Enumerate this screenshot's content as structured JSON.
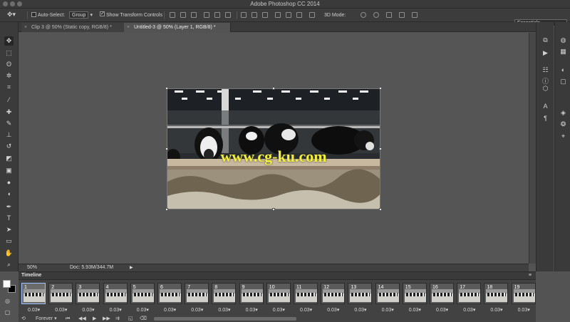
{
  "window": {
    "title": "Adobe Photoshop CC 2014"
  },
  "options_bar": {
    "auto_select_label": "Auto-Select:",
    "auto_select_value": "Group",
    "show_transform_label": "Show Transform Controls",
    "mode_3d_label": "3D Mode:",
    "workspace": "Essentials"
  },
  "tabs": [
    {
      "label": "Clip 3 @ 50% (Static copy, RGB/8) *"
    },
    {
      "label": "Untitled-3 @ 50% (Layer 1, RGB/8) *"
    }
  ],
  "document": {
    "watermark": "www.cg-ku.com"
  },
  "status": {
    "zoom": "50%",
    "doc_size": "Doc: 5.93M/344.7M"
  },
  "timeline": {
    "title": "Timeline",
    "loop": "Forever",
    "frames": [
      {
        "num": "1",
        "delay": "0.03"
      },
      {
        "num": "2",
        "delay": "0.03"
      },
      {
        "num": "3",
        "delay": "0.03"
      },
      {
        "num": "4",
        "delay": "0.03"
      },
      {
        "num": "5",
        "delay": "0.03"
      },
      {
        "num": "6",
        "delay": "0.03"
      },
      {
        "num": "7",
        "delay": "0.03"
      },
      {
        "num": "8",
        "delay": "0.03"
      },
      {
        "num": "9",
        "delay": "0.03"
      },
      {
        "num": "10",
        "delay": "0.03"
      },
      {
        "num": "11",
        "delay": "0.03"
      },
      {
        "num": "12",
        "delay": "0.03"
      },
      {
        "num": "13",
        "delay": "0.03"
      },
      {
        "num": "14",
        "delay": "0.03"
      },
      {
        "num": "15",
        "delay": "0.03"
      },
      {
        "num": "16",
        "delay": "0.03"
      },
      {
        "num": "17",
        "delay": "0.03"
      },
      {
        "num": "18",
        "delay": "0.03"
      },
      {
        "num": "19",
        "delay": "0.03"
      }
    ]
  },
  "colors": {
    "foreground": "#ffffff",
    "background": "#000000",
    "accent": "#9cc3ff"
  },
  "icons": {
    "tools": [
      "move-icon",
      "marquee-icon",
      "lasso-icon",
      "quick-select-icon",
      "crop-icon",
      "eyedropper-icon",
      "healing-icon",
      "brush-icon",
      "stamp-icon",
      "history-brush-icon",
      "eraser-icon",
      "gradient-icon",
      "blur-icon",
      "dodge-icon",
      "pen-icon",
      "type-icon",
      "path-select-icon",
      "shape-icon",
      "hand-icon",
      "zoom-icon"
    ]
  }
}
